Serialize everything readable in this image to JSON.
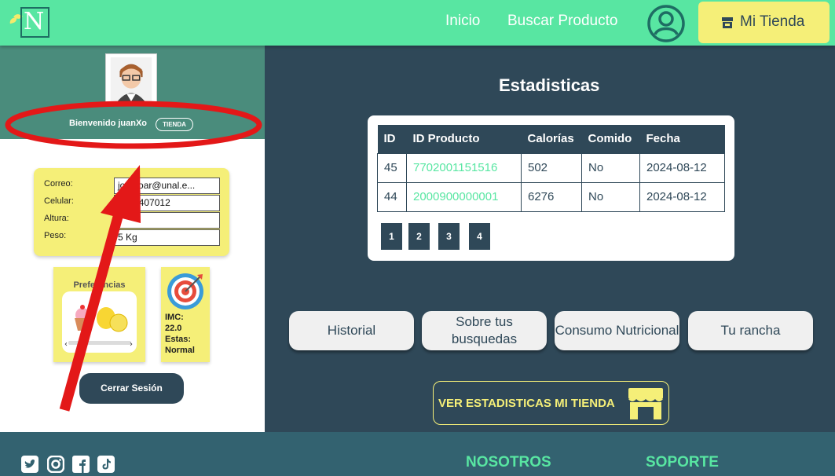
{
  "navbar": {
    "logo_letter": "N",
    "links": [
      "Inicio",
      "Buscar Producto"
    ],
    "store_button": "Mi Tienda"
  },
  "profile": {
    "welcome": "Bienvenido juanXo",
    "badge": "TIENDA",
    "fields": [
      {
        "label": "Correo:",
        "value": "jo      enoar@unal.e..."
      },
      {
        "label": "Celular:",
        "value": "3224407012"
      },
      {
        "label": "Altura:",
        "value": ""
      },
      {
        "label": "Peso:",
        "value": "5 Kg"
      }
    ],
    "preferences_title": "Preferencias",
    "imc_label": "IMC:",
    "imc_value": "22.0",
    "status_label": "Estas:",
    "status_value": "Normal",
    "logout": "Cerrar Sesión"
  },
  "stats": {
    "title": "Estadisticas",
    "columns": [
      "ID",
      "ID Producto",
      "Calorías",
      "Comido",
      "Fecha"
    ],
    "rows": [
      [
        "45",
        "7702001151516",
        "502",
        "No",
        "2024-08-12"
      ],
      [
        "44",
        "2000900000001",
        "6276",
        "No",
        "2024-08-12"
      ]
    ],
    "pages": [
      "1",
      "2",
      "3",
      "4"
    ]
  },
  "actions": [
    "Historial",
    "Sobre tus busquedas",
    "Consumo Nutricional",
    "Tu rancha"
  ],
  "store_stats_button": "VER ESTADISTICAS MI TIENDA",
  "footer": {
    "social_icons": [
      "twitter-icon",
      "instagram-icon",
      "facebook-icon",
      "tiktok-icon"
    ],
    "headings": [
      "NOSOTROS",
      "SOPORTE"
    ]
  },
  "colors": {
    "brand_green": "#58e6a2",
    "dark_teal": "#2f4858",
    "accent_yellow": "#f5ef78",
    "annotation_red": "#e31818"
  }
}
